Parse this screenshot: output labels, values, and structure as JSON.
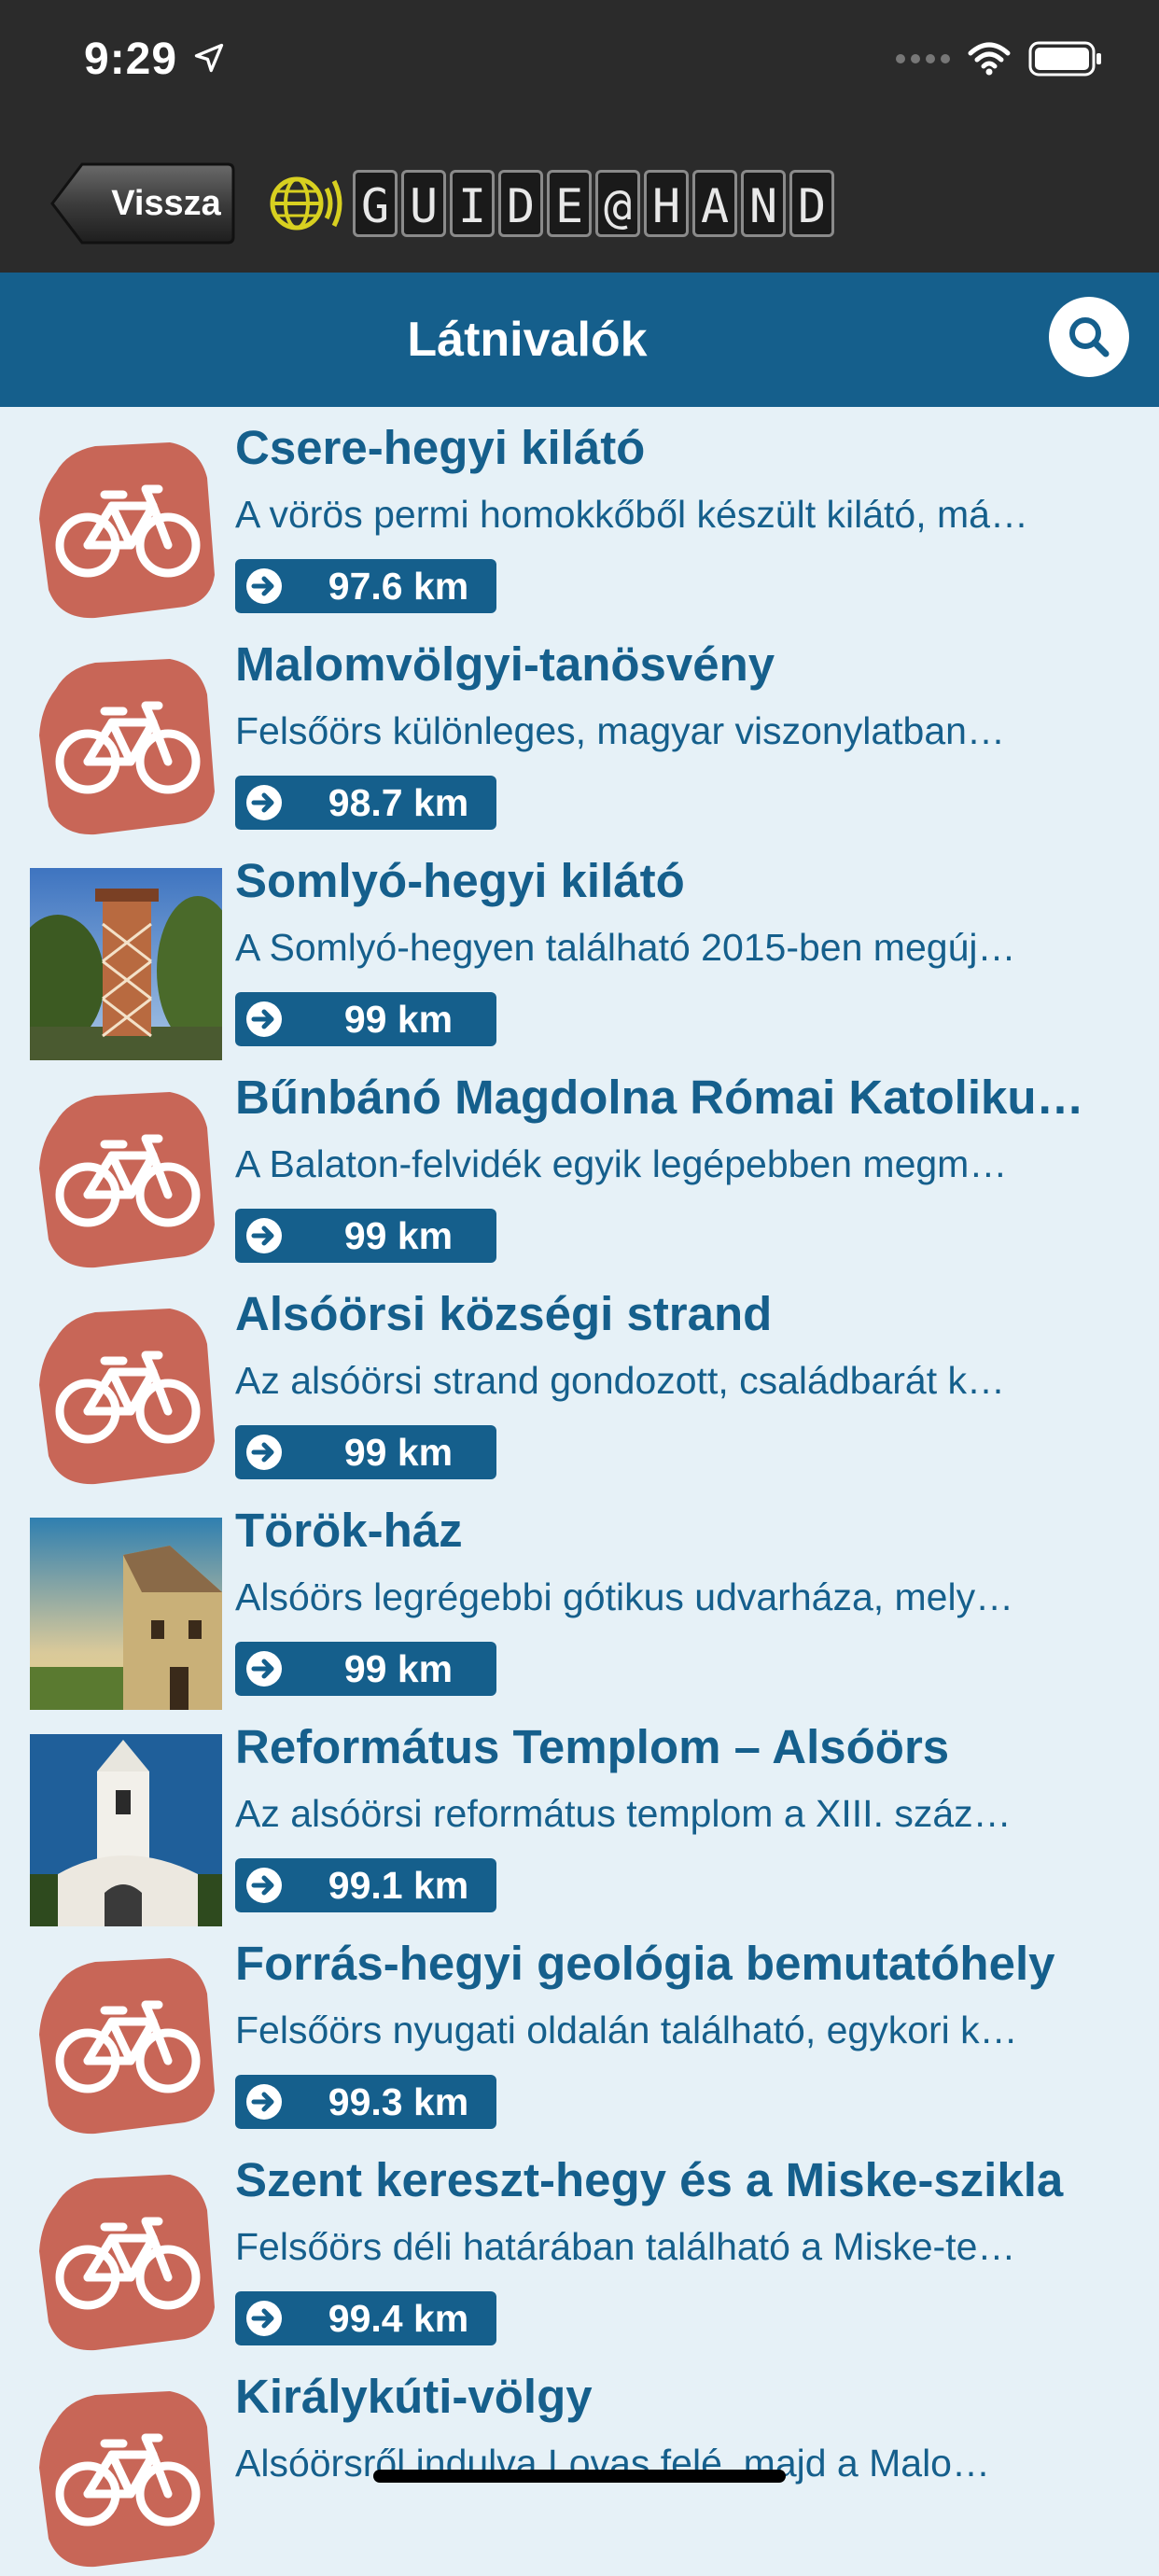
{
  "status_bar": {
    "time": "9:29",
    "icons": [
      "location-arrow-icon",
      "cellular-dots-icon",
      "wifi-icon",
      "battery-icon"
    ]
  },
  "nav": {
    "back_label": "Vissza",
    "logo_letters": [
      "G",
      "U",
      "I",
      "D",
      "E",
      "@",
      "H",
      "A",
      "N",
      "D"
    ]
  },
  "header": {
    "title": "Látnivalók",
    "search_icon": "search-icon"
  },
  "colors": {
    "brand_blue": "#155f8c",
    "background": "#e6f1f7",
    "bike_red": "#c86657",
    "dark_bar": "#2b2b2b"
  },
  "items": [
    {
      "title": "Csere-hegyi kilátó",
      "description": "A vörös permi homokkőből készült kilátó, má…",
      "distance": "97.6 km",
      "thumb": "bike-icon"
    },
    {
      "title": "Malomvölgyi-tanösvény",
      "description": "Felsőörs különleges, magyar viszonylatban…",
      "distance": "98.7 km",
      "thumb": "bike-icon"
    },
    {
      "title": "Somlyó-hegyi kilátó",
      "description": "A Somlyó-hegyen található 2015-ben megúj…",
      "distance": "99 km",
      "thumb": "tower-photo"
    },
    {
      "title": "Bűnbánó Magdolna Római Katoliku…",
      "description": "A Balaton-felvidék egyik legépebben megm…",
      "distance": "99 km",
      "thumb": "bike-icon"
    },
    {
      "title": "Alsóörsi községi strand",
      "description": "Az alsóörsi strand gondozott, családbarát k…",
      "distance": "99 km",
      "thumb": "bike-icon"
    },
    {
      "title": "Török-ház",
      "description": "Alsóörs legrégebbi gótikus udvarháza, mely…",
      "distance": "99 km",
      "thumb": "house-photo"
    },
    {
      "title": "Református Templom – Alsóörs",
      "description": "Az alsóörsi református templom  a XIII. száz…",
      "distance": "99.1 km",
      "thumb": "church-photo"
    },
    {
      "title": "Forrás-hegyi geológia bemutatóhely",
      "description": "Felsőörs nyugati oldalán található, egykori k…",
      "distance": "99.3 km",
      "thumb": "bike-icon"
    },
    {
      "title": "Szent kereszt-hegy és a Miske-szikla",
      "description": "Felsőörs déli határában található a Miske-te…",
      "distance": "99.4 km",
      "thumb": "bike-icon"
    },
    {
      "title": "Királykúti-völgy",
      "description": "Alsóörsről indulva Lovas felé, majd a Malo…",
      "distance": "",
      "thumb": "bike-icon"
    }
  ]
}
